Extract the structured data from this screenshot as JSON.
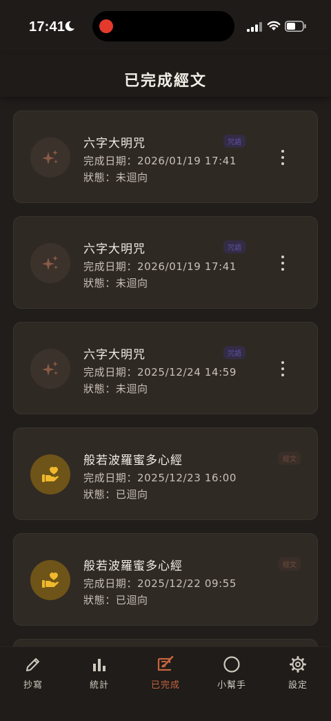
{
  "status_bar": {
    "time": "17:41"
  },
  "header": {
    "title": "已完成經文"
  },
  "cards": [
    {
      "title": "六字大明咒",
      "date": "完成日期：2026/01/19 17:41",
      "status": "狀態：未迴向",
      "tag": "咒語",
      "icon": "sparkles-icon",
      "has_menu": true
    },
    {
      "title": "六字大明咒",
      "date": "完成日期：2026/01/19 17:41",
      "status": "狀態：未迴向",
      "tag": "咒語",
      "icon": "sparkles-icon",
      "has_menu": true
    },
    {
      "title": "六字大明咒",
      "date": "完成日期：2025/12/24 14:59",
      "status": "狀態：未迴向",
      "tag": "咒語",
      "icon": "sparkles-icon",
      "has_menu": true
    },
    {
      "title": "般若波羅蜜多心經",
      "date": "完成日期：2025/12/23 16:00",
      "status": "狀態：已迴向",
      "tag": "經文",
      "icon": "hand-heart-icon",
      "has_menu": false
    },
    {
      "title": "般若波羅蜜多心經",
      "date": "完成日期：2025/12/22 09:55",
      "status": "狀態：已迴向",
      "tag": "經文",
      "icon": "hand-heart-icon",
      "has_menu": false
    }
  ],
  "tabs": [
    {
      "label": "抄寫",
      "icon": "pencil-icon"
    },
    {
      "label": "統計",
      "icon": "bar-chart-icon"
    },
    {
      "label": "已完成",
      "icon": "brush-icon",
      "active": true
    },
    {
      "label": "小幫手",
      "icon": "circle-icon"
    },
    {
      "label": "設定",
      "icon": "gear-icon"
    }
  ],
  "colors": {
    "accent": "#c7643f",
    "gold": "#e4b02e",
    "background": "#201d1a",
    "card": "#2f2924"
  }
}
